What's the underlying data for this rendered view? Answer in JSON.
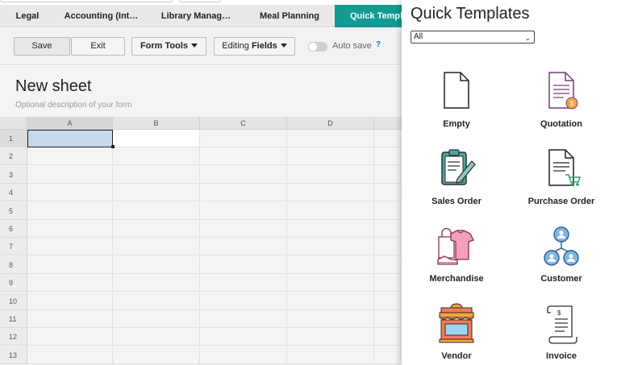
{
  "tabs": [
    "Legal",
    "Accounting (Int…",
    "Library Manag…",
    "Meal Planning",
    "Quick Templat"
  ],
  "toolbar": {
    "save_label": "Save",
    "exit_label": "Exit",
    "form_tools_label": "Form Tools",
    "editing_prefix": "Editing ",
    "editing_bold": "Fields",
    "autosave_label": "Auto save",
    "help_label": "?"
  },
  "sheet": {
    "title": "New sheet",
    "description": "Optional description of your form",
    "columns": [
      "A",
      "B",
      "C",
      "D"
    ],
    "rows": [
      "1",
      "2",
      "3",
      "4",
      "5",
      "6",
      "7",
      "8",
      "9",
      "10",
      "11",
      "12",
      "13"
    ]
  },
  "panel": {
    "title": "Quick Templates",
    "filter_value": "All",
    "templates": [
      {
        "label": "Empty",
        "icon": "empty-document-icon"
      },
      {
        "label": "Quotation",
        "icon": "quotation-icon"
      },
      {
        "label": "Sales Order",
        "icon": "sales-order-icon"
      },
      {
        "label": "Purchase Order",
        "icon": "purchase-order-icon"
      },
      {
        "label": "Merchandise",
        "icon": "merchandise-icon"
      },
      {
        "label": "Customer",
        "icon": "customer-icon"
      },
      {
        "label": "Vendor",
        "icon": "vendor-icon"
      },
      {
        "label": "Invoice",
        "icon": "invoice-icon"
      }
    ]
  },
  "colors": {
    "accent_tab": "#139a92",
    "selected_cell": "#c9d7ea"
  }
}
